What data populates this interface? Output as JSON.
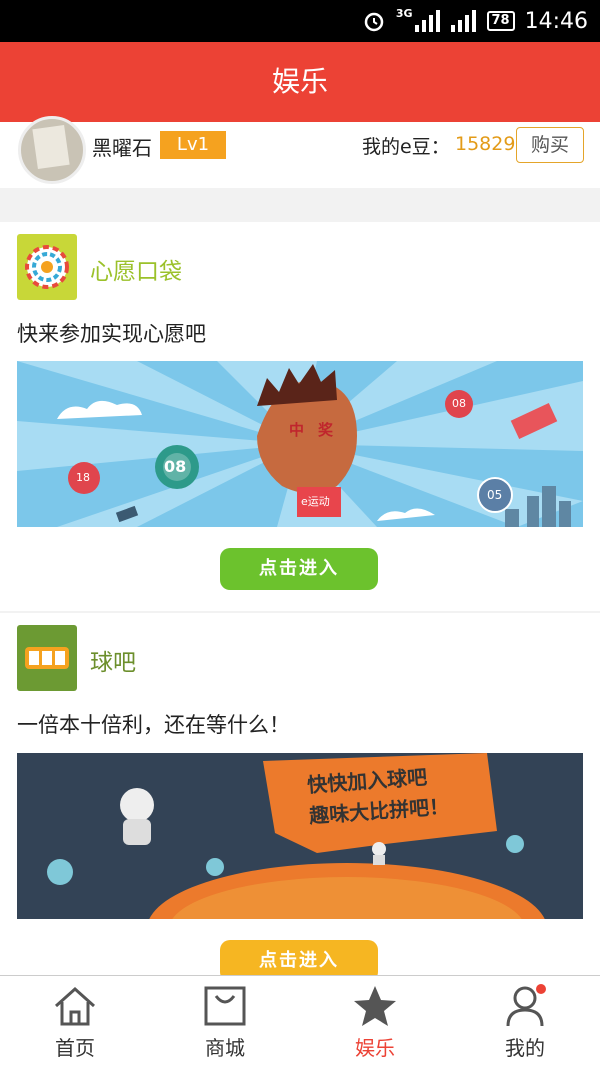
{
  "status_bar": {
    "network": "3G",
    "battery": "78",
    "time": "14:46"
  },
  "header": {
    "title": "娱乐"
  },
  "profile": {
    "username": "黑曜石",
    "level": "Lv1",
    "beans_label": "我的e豆：",
    "beans_value": "15829",
    "buy_label": "购买"
  },
  "sections": [
    {
      "title": "心愿口袋",
      "description": "快来参加实现心愿吧",
      "enter_label": "点击进入",
      "banner": {
        "center_text": "中奖",
        "badge": "e运动",
        "balls": [
          "18",
          "08",
          "08",
          "05"
        ]
      },
      "colors": {
        "title": "#9bc12a",
        "icon_bg": "#c8d738",
        "button": "#6cc22d",
        "banner_bg": "#7cc7ea"
      }
    },
    {
      "title": "球吧",
      "description": "一倍本十倍利，还在等什么！",
      "enter_label": "点击进入",
      "banner": {
        "line1": "快快加入球吧",
        "line2": "趣味大比拼吧！"
      },
      "colors": {
        "title": "#6c8f2c",
        "icon_bg": "#6c9a33",
        "button": "#f6b622",
        "banner_bg": "#334356"
      }
    }
  ],
  "tabbar": {
    "tabs": [
      {
        "label": "首页",
        "icon": "home-icon"
      },
      {
        "label": "商城",
        "icon": "shopping-bag-icon"
      },
      {
        "label": "娱乐",
        "icon": "star-icon",
        "active": true
      },
      {
        "label": "我的",
        "icon": "user-icon",
        "has_badge": true
      }
    ],
    "active_color": "#ec4235"
  }
}
